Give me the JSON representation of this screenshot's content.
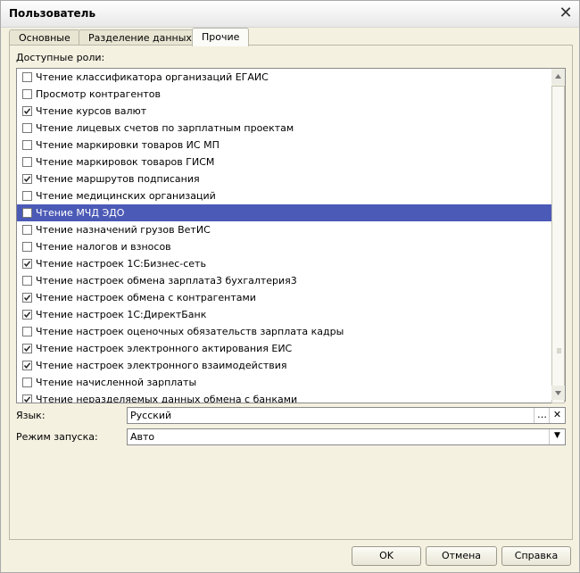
{
  "window": {
    "title": "Пользователь"
  },
  "tabs": [
    {
      "label": "Основные",
      "active": false
    },
    {
      "label": "Разделение данных",
      "active": false
    },
    {
      "label": "Прочие",
      "active": true
    }
  ],
  "roles": {
    "caption": "Доступные роли:",
    "items": [
      {
        "label": "Чтение классификатора организаций ЕГАИС",
        "checked": false
      },
      {
        "label": "Просмотр контрагентов",
        "checked": false
      },
      {
        "label": "Чтение курсов валют",
        "checked": true
      },
      {
        "label": "Чтение лицевых счетов по зарплатным проектам",
        "checked": false
      },
      {
        "label": "Чтение маркировки товаров ИС МП",
        "checked": false
      },
      {
        "label": "Чтение маркировок товаров ГИСМ",
        "checked": false
      },
      {
        "label": "Чтение маршрутов подписания",
        "checked": true
      },
      {
        "label": "Чтение медицинских организаций",
        "checked": false
      },
      {
        "label": "Чтение МЧД ЭДО",
        "checked": false,
        "selected": true
      },
      {
        "label": "Чтение назначений грузов ВетИС",
        "checked": false
      },
      {
        "label": "Чтение налогов и взносов",
        "checked": false
      },
      {
        "label": "Чтение настроек 1С:Бизнес-сеть",
        "checked": true
      },
      {
        "label": "Чтение настроек обмена зарплата3 бухгалтерия3",
        "checked": false
      },
      {
        "label": "Чтение настроек обмена с контрагентами",
        "checked": true
      },
      {
        "label": "Чтение настроек 1С:ДиректБанк",
        "checked": true
      },
      {
        "label": "Чтение настроек оценочных обязательств зарплата кадры",
        "checked": false
      },
      {
        "label": "Чтение настроек электронного актирования ЕИС",
        "checked": true
      },
      {
        "label": "Чтение настроек электронного взаимодействия",
        "checked": true
      },
      {
        "label": "Чтение начисленной зарплаты",
        "checked": false
      },
      {
        "label": "Чтение неразделяемых данных обмена с банками",
        "checked": true
      }
    ]
  },
  "language": {
    "label": "Язык:",
    "value": "Русский",
    "select_icon": "…",
    "clear_icon": "✕"
  },
  "launch_mode": {
    "label": "Режим запуска:",
    "value": "Авто",
    "dropdown_icon": "▼"
  },
  "buttons": {
    "ok": "OK",
    "cancel": "Отмена",
    "help": "Справка"
  },
  "colors": {
    "selection": "#4b5ab6",
    "background": "#f4f1e1"
  }
}
